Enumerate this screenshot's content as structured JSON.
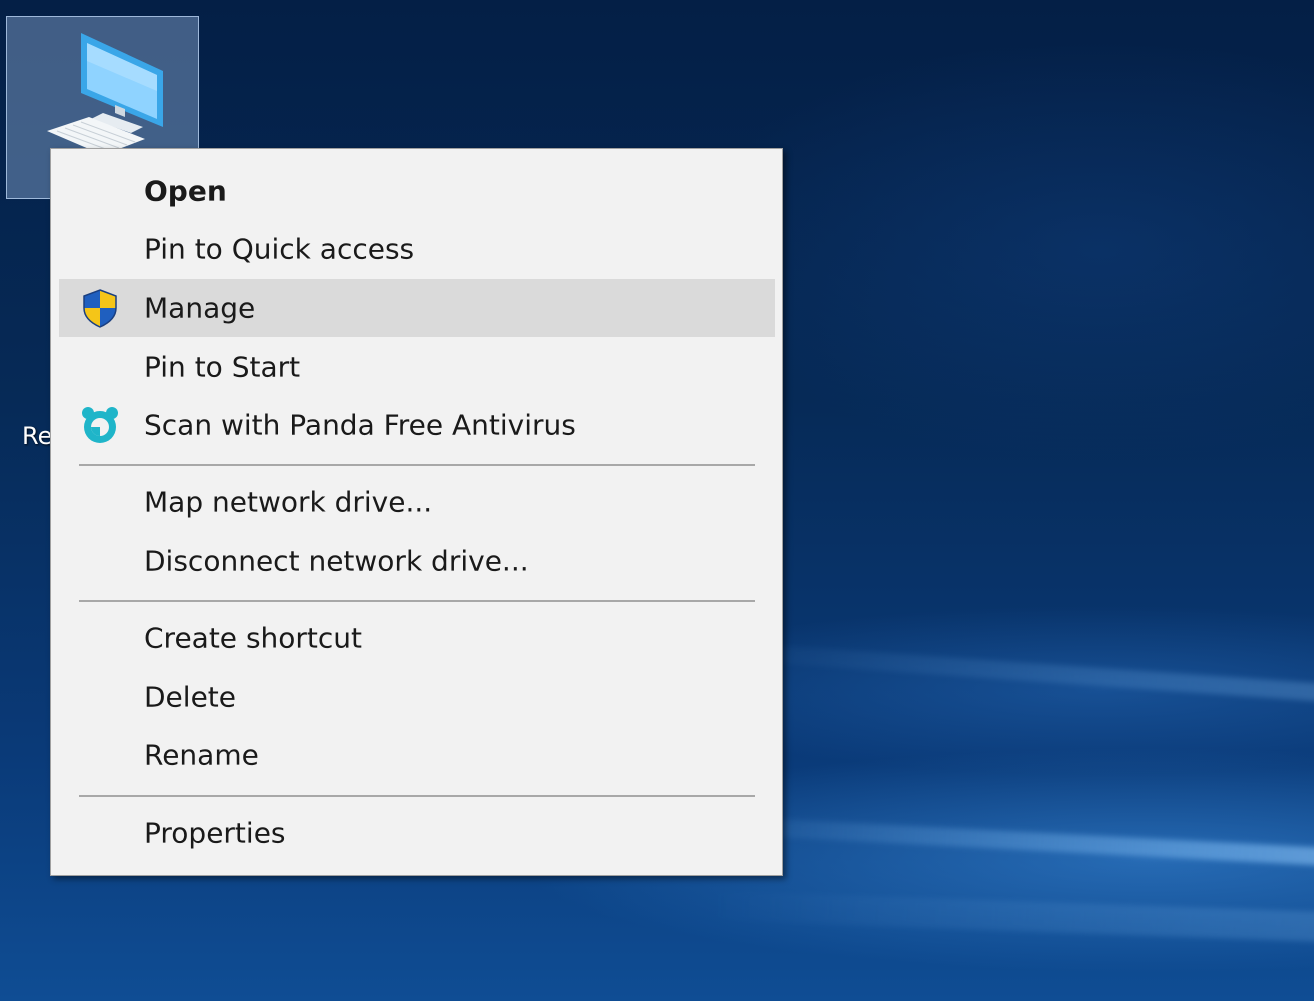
{
  "desktop": {
    "icon_label": "Re",
    "icon_name": "this-pc-icon"
  },
  "context_menu": {
    "items": [
      {
        "label": "Open",
        "bold": true,
        "icon": null,
        "highlighted": false
      },
      {
        "label": "Pin to Quick access",
        "bold": false,
        "icon": null,
        "highlighted": false
      },
      {
        "label": "Manage",
        "bold": false,
        "icon": "uac-shield-icon",
        "highlighted": true
      },
      {
        "label": "Pin to Start",
        "bold": false,
        "icon": null,
        "highlighted": false
      },
      {
        "label": "Scan with Panda Free Antivirus",
        "bold": false,
        "icon": "panda-antivirus-icon",
        "highlighted": false
      },
      {
        "label": "Map network drive...",
        "bold": false,
        "icon": null,
        "highlighted": false
      },
      {
        "label": "Disconnect network drive...",
        "bold": false,
        "icon": null,
        "highlighted": false
      },
      {
        "label": "Create shortcut",
        "bold": false,
        "icon": null,
        "highlighted": false
      },
      {
        "label": "Delete",
        "bold": false,
        "icon": null,
        "highlighted": false
      },
      {
        "label": "Rename",
        "bold": false,
        "icon": null,
        "highlighted": false
      },
      {
        "label": "Properties",
        "bold": false,
        "icon": null,
        "highlighted": false
      }
    ]
  },
  "colors": {
    "menu_background": "#f2f2f2",
    "menu_highlight": "#dadada",
    "shield_blue": "#1f5fbf",
    "shield_yellow": "#f5c518",
    "panda_teal": "#1fb5c9"
  }
}
